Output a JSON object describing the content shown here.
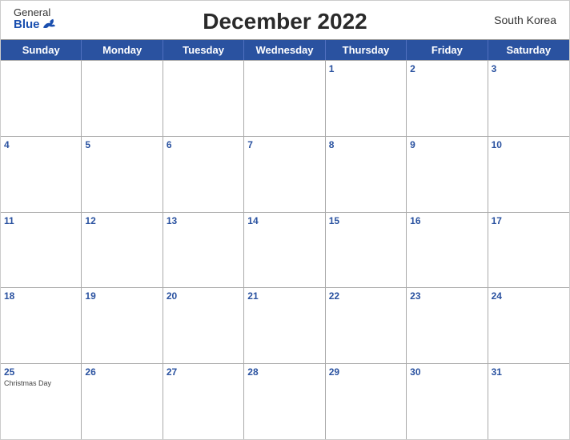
{
  "header": {
    "logo": {
      "general": "General",
      "blue": "Blue"
    },
    "title": "December 2022",
    "country": "South Korea"
  },
  "dayHeaders": [
    "Sunday",
    "Monday",
    "Tuesday",
    "Wednesday",
    "Thursday",
    "Friday",
    "Saturday"
  ],
  "weeks": [
    [
      {
        "day": "",
        "empty": true
      },
      {
        "day": "",
        "empty": true
      },
      {
        "day": "",
        "empty": true
      },
      {
        "day": "",
        "empty": true
      },
      {
        "day": "1"
      },
      {
        "day": "2"
      },
      {
        "day": "3"
      }
    ],
    [
      {
        "day": "4"
      },
      {
        "day": "5"
      },
      {
        "day": "6"
      },
      {
        "day": "7"
      },
      {
        "day": "8"
      },
      {
        "day": "9"
      },
      {
        "day": "10"
      }
    ],
    [
      {
        "day": "11"
      },
      {
        "day": "12"
      },
      {
        "day": "13"
      },
      {
        "day": "14"
      },
      {
        "day": "15"
      },
      {
        "day": "16"
      },
      {
        "day": "17"
      }
    ],
    [
      {
        "day": "18"
      },
      {
        "day": "19"
      },
      {
        "day": "20"
      },
      {
        "day": "21"
      },
      {
        "day": "22"
      },
      {
        "day": "23"
      },
      {
        "day": "24"
      }
    ],
    [
      {
        "day": "25",
        "event": "Christmas Day"
      },
      {
        "day": "26"
      },
      {
        "day": "27"
      },
      {
        "day": "28"
      },
      {
        "day": "29"
      },
      {
        "day": "30"
      },
      {
        "day": "31"
      }
    ]
  ],
  "colors": {
    "header_bg": "#2a52a0",
    "header_text": "#ffffff",
    "day_number": "#2a52a0"
  }
}
